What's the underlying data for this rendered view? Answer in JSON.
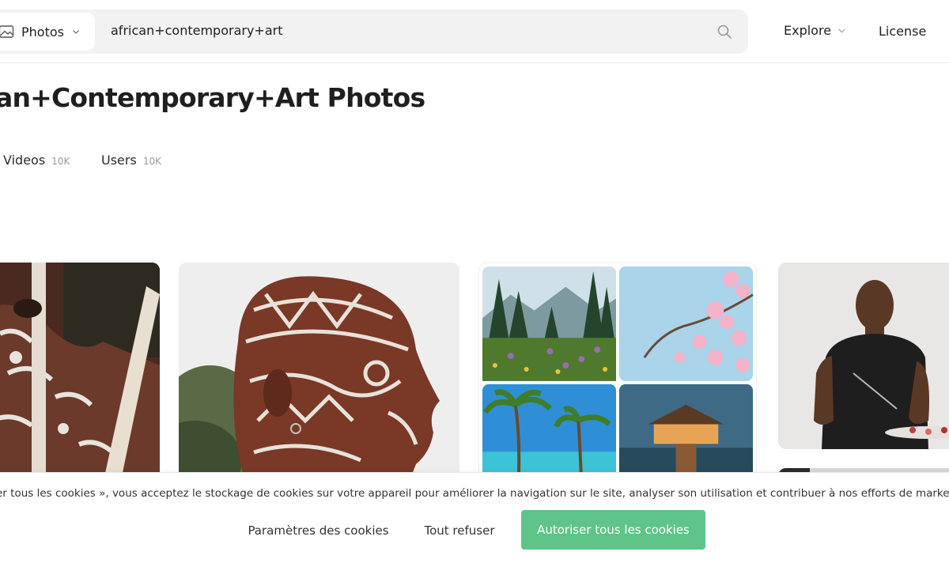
{
  "header": {
    "type_selector": "Photos",
    "search_value": "african+contemporary+art",
    "nav_explore": "Explore",
    "nav_license": "License"
  },
  "page": {
    "title": "an+Contemporary+Art Photos"
  },
  "tabs": [
    {
      "label": "Videos",
      "count": "10K"
    },
    {
      "label": "Users",
      "count": "10K"
    }
  ],
  "grid": {
    "items": [
      {
        "icon": "photo-body-paint"
      },
      {
        "icon": "photo-face-paint"
      },
      {
        "icon": "photo-collage-landscapes"
      },
      {
        "icon": "photo-painter-man"
      },
      {
        "icon": "photo-dark"
      }
    ]
  },
  "cookies": {
    "text": "er tous les cookies », vous acceptez le stockage de cookies sur votre appareil pour améliorer la navigation sur le site, analyser son utilisation et contribuer à nos efforts de marketing.",
    "settings_label": "Paramètres des cookies",
    "refuse_label": "Tout refuser",
    "accept_label": "Autoriser tous les cookies",
    "accept_color": "#5ec488"
  }
}
